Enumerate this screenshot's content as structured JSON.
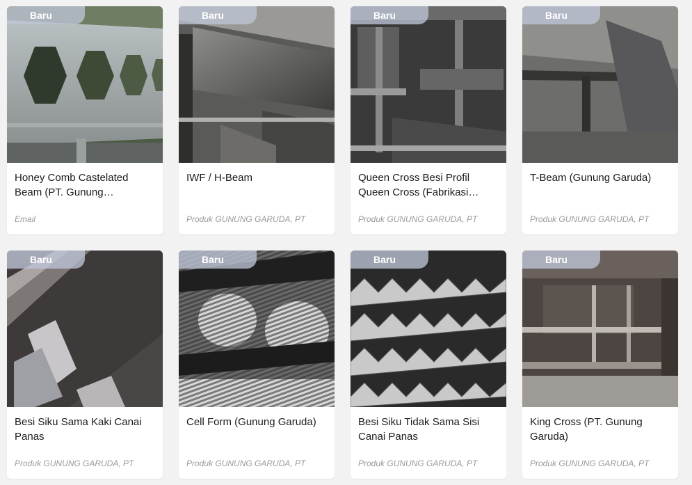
{
  "products": [
    {
      "badge": "Baru",
      "title": "Honey Comb Castelated Beam (PT. Gunung…",
      "seller": "Email",
      "image": "castellated-beam-photo"
    },
    {
      "badge": "Baru",
      "title": "IWF / H-Beam",
      "seller": "Produk GUNUNG GARUDA, PT",
      "image": "h-beam-photo"
    },
    {
      "badge": "Baru",
      "title": "Queen Cross Besi Profil Queen Cross (Fabrikasi…",
      "seller": "Produk GUNUNG GARUDA, PT",
      "image": "queen-cross-photo"
    },
    {
      "badge": "Baru",
      "title": "T-Beam (Gunung Garuda)",
      "seller": "Produk GUNUNG GARUDA, PT",
      "image": "t-beam-photo"
    },
    {
      "badge": "Baru",
      "title": "Besi Siku Sama Kaki Canai Panas",
      "seller": "Produk GUNUNG GARUDA, PT",
      "image": "equal-angle-photo"
    },
    {
      "badge": "Baru",
      "title": "Cell Form (Gunung Garuda)",
      "seller": "Produk GUNUNG GARUDA, PT",
      "image": "cell-form-photo"
    },
    {
      "badge": "Baru",
      "title": "Besi Siku Tidak Sama Sisi Canai Panas",
      "seller": "Produk GUNUNG GARUDA, PT",
      "image": "unequal-angle-photo"
    },
    {
      "badge": "Baru",
      "title": "King Cross (PT. Gunung Garuda)",
      "seller": "Produk GUNUNG GARUDA, PT",
      "image": "king-cross-photo"
    }
  ],
  "colors": {
    "badge_bg": "#bec4d6",
    "title": "#1b1b1b",
    "seller": "#9a9a9a",
    "page_bg": "#f2f2f2"
  }
}
